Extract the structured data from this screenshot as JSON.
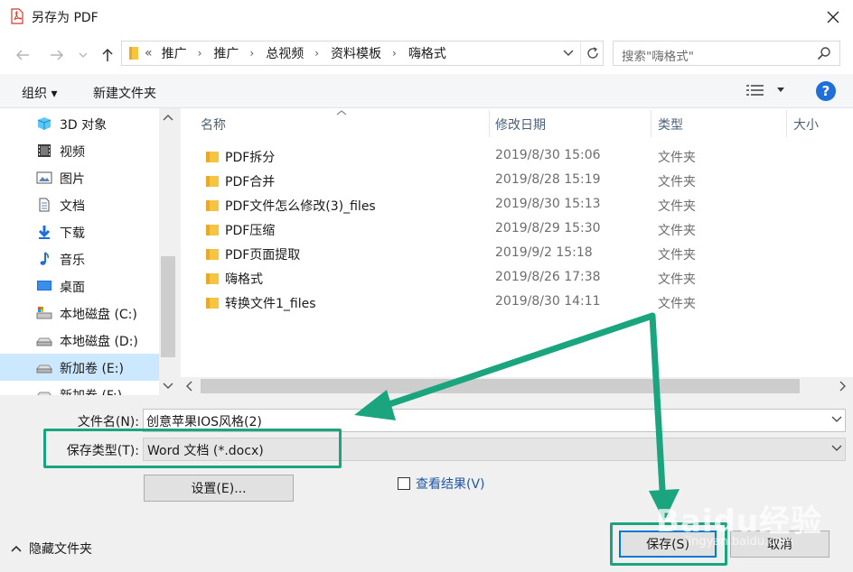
{
  "window": {
    "title": "另存为 PDF"
  },
  "address": {
    "overflow": "«",
    "crumbs": [
      "推广",
      "推广",
      "总视频",
      "资料模板",
      "嗨格式"
    ]
  },
  "search": {
    "placeholder": "搜索\"嗨格式\""
  },
  "toolbar": {
    "organize_label": "组织 ▾",
    "new_folder_label": "新建文件夹",
    "help_label": "?"
  },
  "nav_items": [
    {
      "label": "3D 对象",
      "icon": "3d-objects-icon"
    },
    {
      "label": "视频",
      "icon": "video-icon"
    },
    {
      "label": "图片",
      "icon": "picture-icon"
    },
    {
      "label": "文档",
      "icon": "document-icon"
    },
    {
      "label": "下载",
      "icon": "download-icon"
    },
    {
      "label": "音乐",
      "icon": "music-icon"
    },
    {
      "label": "桌面",
      "icon": "desktop-icon"
    },
    {
      "label": "本地磁盘 (C:)",
      "icon": "drive-c-icon"
    },
    {
      "label": "本地磁盘 (D:)",
      "icon": "drive-icon"
    },
    {
      "label": "新加卷 (E:)",
      "icon": "drive-icon"
    },
    {
      "label": "新加卷 (F:)",
      "icon": "drive-icon"
    }
  ],
  "columns": {
    "name": "名称",
    "modified": "修改日期",
    "type": "类型",
    "size": "大小"
  },
  "files": [
    {
      "name": "PDF拆分",
      "date": "2019/8/30 15:06",
      "type": "文件夹"
    },
    {
      "name": "PDF合并",
      "date": "2019/8/28 15:19",
      "type": "文件夹"
    },
    {
      "name": "PDF文件怎么修改(3)_files",
      "date": "2019/8/30 15:13",
      "type": "文件夹"
    },
    {
      "name": "PDF压缩",
      "date": "2019/8/29 15:30",
      "type": "文件夹"
    },
    {
      "name": "PDF页面提取",
      "date": "2019/9/2 15:18",
      "type": "文件夹"
    },
    {
      "name": "嗨格式",
      "date": "2019/8/26 17:38",
      "type": "文件夹"
    },
    {
      "name": "转换文件1_files",
      "date": "2019/8/30 14:11",
      "type": "文件夹"
    }
  ],
  "form": {
    "filename_label": "文件名(N):",
    "filename_value": "创意苹果IOS风格(2)",
    "filetype_label": "保存类型(T):",
    "filetype_value": "Word 文档 (*.docx)",
    "settings_label": "设置(E)...",
    "view_result_label": "查看结果(V)",
    "hide_folders_label": "隐藏文件夹",
    "save_label": "保存(S)",
    "cancel_label": "取消"
  },
  "watermark": {
    "text": "Baidu经验",
    "url_text": "jingyan.baidu.com"
  },
  "colors": {
    "accent": "#0078d7",
    "annotation": "#1aa57f",
    "selected": "#cce8ff",
    "folder": "#f6c441"
  }
}
